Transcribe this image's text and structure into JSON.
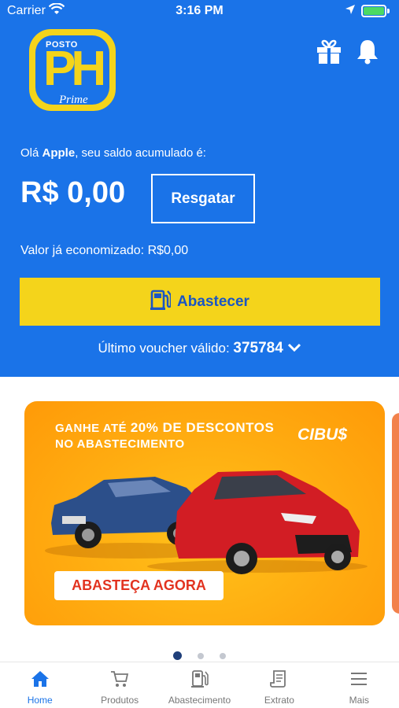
{
  "status_bar": {
    "carrier": "Carrier",
    "time": "3:16 PM"
  },
  "logo": {
    "posto": "POSTO",
    "ph": "PH",
    "prime": "Prime"
  },
  "header": {
    "greeting_prefix": "Olá ",
    "user_name": "Apple",
    "greeting_suffix": ", seu saldo acumulado é:",
    "balance": "R$ 0,00",
    "redeem_label": "Resgatar",
    "saved_text": "Valor já economizado: R$0,00",
    "refuel_label": "Abastecer",
    "voucher_label": "Último voucher válido: ",
    "voucher_code": "375784"
  },
  "banner": {
    "line1_prefix": "GANHE ATÉ ",
    "line1_highlight": "20% DE DESCONTOS",
    "line2": "NO ABASTECIMENTO",
    "brand": "CIBU$",
    "cta": "ABASTEÇA AGORA"
  },
  "carousel": {
    "total": 3,
    "active": 1
  },
  "tabs": [
    {
      "label": "Home",
      "icon": "home-icon",
      "active": true
    },
    {
      "label": "Produtos",
      "icon": "cart-icon",
      "active": false
    },
    {
      "label": "Abastecimento",
      "icon": "fuel-pump-icon",
      "active": false
    },
    {
      "label": "Extrato",
      "icon": "receipt-icon",
      "active": false
    },
    {
      "label": "Mais",
      "icon": "menu-icon",
      "active": false
    }
  ],
  "colors": {
    "primary": "#1a73e8",
    "accent": "#f4d41b",
    "banner": "#ffab10",
    "cta_text": "#e23320"
  }
}
